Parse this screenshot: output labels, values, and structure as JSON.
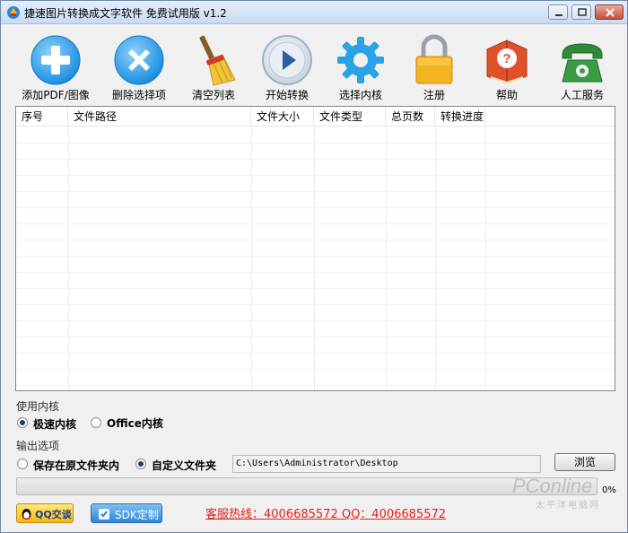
{
  "window": {
    "title": "捷速图片转换成文字软件 免费试用版 v1.2"
  },
  "toolbar": {
    "items": [
      {
        "label": "添加PDF/图像",
        "icon": "add-icon"
      },
      {
        "label": "删除选择项",
        "icon": "delete-icon"
      },
      {
        "label": "清空列表",
        "icon": "broom-icon"
      },
      {
        "label": "开始转换",
        "icon": "play-icon"
      },
      {
        "label": "选择内核",
        "icon": "gear-icon"
      },
      {
        "label": "注册",
        "icon": "lock-icon"
      },
      {
        "label": "帮助",
        "icon": "help-book-icon"
      },
      {
        "label": "人工服务",
        "icon": "phone-icon"
      }
    ]
  },
  "table": {
    "columns": [
      "序号",
      "文件路径",
      "文件大小",
      "文件类型",
      "总页数",
      "转换进度"
    ],
    "rows": []
  },
  "engine": {
    "section_label": "使用内核",
    "options": [
      "极速内核",
      "Office内核"
    ],
    "selected": "极速内核"
  },
  "output": {
    "section_label": "输出选项",
    "options": [
      "保存在原文件夹内",
      "自定义文件夹"
    ],
    "selected": "自定义文件夹",
    "path": "C:\\Users\\Administrator\\Desktop",
    "browse_label": "浏览"
  },
  "progress": {
    "value": 0,
    "label": "0%"
  },
  "footer": {
    "qq_label": "QQ交谈",
    "sdk_label": "SDK定制",
    "hotline": "客服热线：4006685572 QQ：4006685572"
  },
  "watermark": {
    "text": "PConline",
    "subtext": "太平洋电脑网"
  },
  "colors": {
    "hotline": "#e0211d",
    "accent_blue": "#2c86d6"
  }
}
